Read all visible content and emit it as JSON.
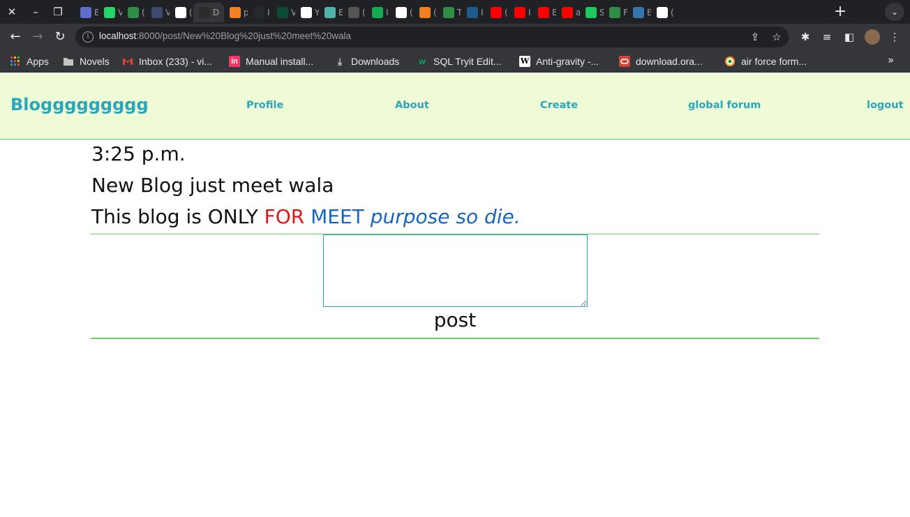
{
  "browser": {
    "url_host": "localhost",
    "url_path": ":8000/post/New%20Blog%20just%20meet%20wala",
    "tabs": [
      {
        "icon": "generic-page-icon",
        "color": "#5f6ec9",
        "letter": "E"
      },
      {
        "icon": "whatsapp-icon",
        "color": "#25d366",
        "letter": "V"
      },
      {
        "icon": "geeksforgeeks-icon",
        "color": "#2f8d46",
        "letter": "("
      },
      {
        "icon": "generic-page-icon",
        "color": "#3c4a6e",
        "letter": "V"
      },
      {
        "icon": "google-icon",
        "color": "#ffffff",
        "letter": "("
      },
      {
        "icon": "django-docs-icon",
        "color": "#2b2b2b",
        "letter": "D",
        "active": true
      },
      {
        "icon": "stackoverflow-icon",
        "color": "#f48024",
        "letter": "p"
      },
      {
        "icon": "github-icon",
        "color": "#24292e",
        "letter": "I"
      },
      {
        "icon": "django-icon",
        "color": "#0c4b33",
        "letter": "V"
      },
      {
        "icon": "google-icon",
        "color": "#ffffff",
        "letter": "Y"
      },
      {
        "icon": "generic-page-icon",
        "color": "#4fb3a9",
        "letter": "E"
      },
      {
        "icon": "generic-page-icon",
        "color": "#555555",
        "letter": "("
      },
      {
        "icon": "mongodb-icon",
        "color": "#13aa52",
        "letter": "I"
      },
      {
        "icon": "globe-icon",
        "color": "#ffffff",
        "letter": "("
      },
      {
        "icon": "stackoverflow-icon",
        "color": "#f48024",
        "letter": "("
      },
      {
        "icon": "geeksforgeeks-icon",
        "color": "#2f8d46",
        "letter": "T"
      },
      {
        "icon": "generic-page-icon",
        "color": "#1e5b8c",
        "letter": "I"
      },
      {
        "icon": "youtube-icon",
        "color": "#ff0000",
        "letter": "("
      },
      {
        "icon": "youtube-icon",
        "color": "#ff0000",
        "letter": "I"
      },
      {
        "icon": "youtube-icon",
        "color": "#ff0000",
        "letter": "E"
      },
      {
        "icon": "youtube-icon",
        "color": "#ff0000",
        "letter": "a"
      },
      {
        "icon": "generic-page-icon",
        "color": "#22c55e",
        "letter": "S"
      },
      {
        "icon": "geeksforgeeks-icon",
        "color": "#2f8d46",
        "letter": "F"
      },
      {
        "icon": "python-icon",
        "color": "#3776ab",
        "letter": "E"
      },
      {
        "icon": "google-icon",
        "color": "#ffffff",
        "letter": "("
      }
    ]
  },
  "bookmarks": [
    {
      "label": "Apps",
      "icon": "apps-grid-icon"
    },
    {
      "label": "Novels",
      "icon": "folder-icon"
    },
    {
      "label": "Inbox (233) - vi...",
      "icon": "gmail-icon"
    },
    {
      "label": "Manual install...",
      "icon": "invision-icon"
    },
    {
      "label": "Downloads",
      "icon": "download-icon"
    },
    {
      "label": "SQL Tryit Edit...",
      "icon": "w3schools-icon"
    },
    {
      "label": "Anti-gravity -...",
      "icon": "wikipedia-icon"
    },
    {
      "label": "download.ora...",
      "icon": "oracle-icon"
    },
    {
      "label": "air force form...",
      "icon": "indian-air-force-icon"
    }
  ],
  "site": {
    "brand": "Bloggggggggg",
    "nav": [
      "Profile",
      "About",
      "Create",
      "global forum",
      "logout"
    ]
  },
  "post": {
    "time": "3:25 p.m.",
    "title": "New Blog just meet wala",
    "body": {
      "plain": "This blog is ONLY ",
      "red": "FOR",
      "space": " ",
      "blue": "MEET",
      "space2": " ",
      "blue_italic": "purpose so die."
    }
  },
  "comment_form": {
    "textarea_value": "",
    "submit_label": "post"
  },
  "colors": {
    "header_bg": "#effbd7",
    "accent": "#2aa7b8",
    "rule": "#5fd36a",
    "red": "#d81818",
    "blue": "#1565c0"
  }
}
